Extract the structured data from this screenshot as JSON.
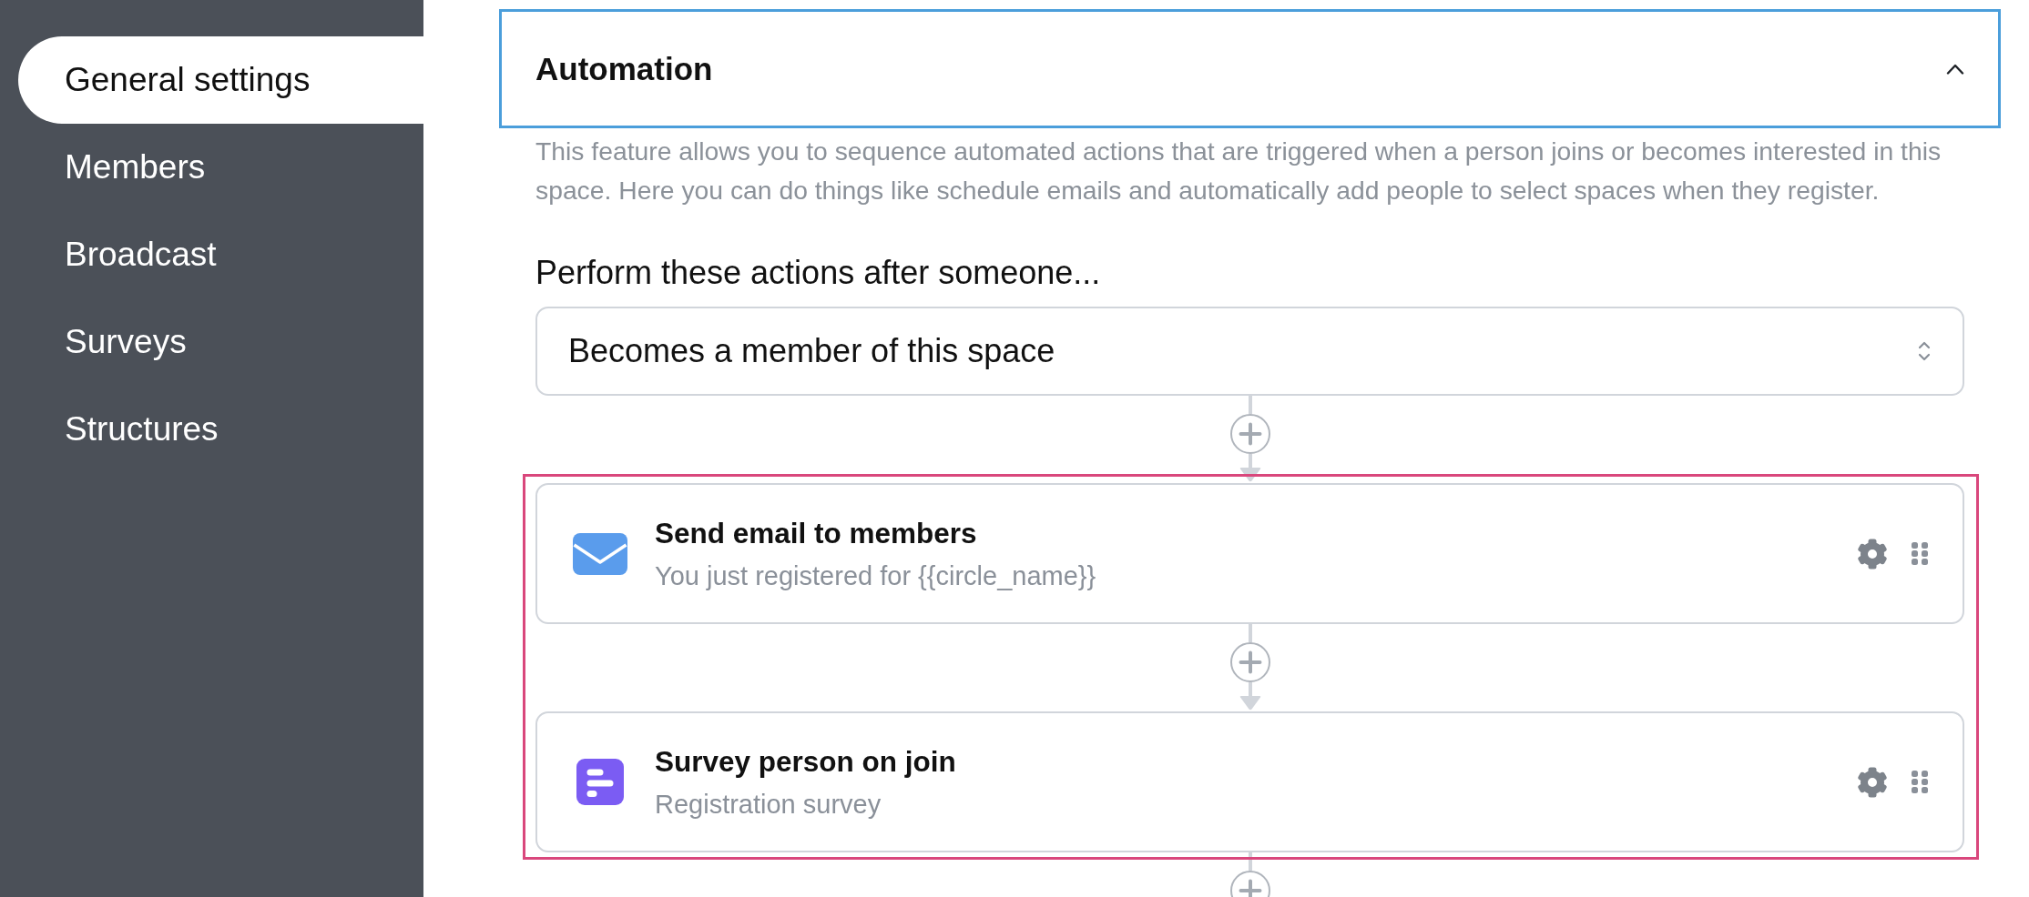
{
  "sidebar": {
    "items": [
      {
        "label": "General settings",
        "selected": true
      },
      {
        "label": "Members",
        "selected": false
      },
      {
        "label": "Broadcast",
        "selected": false
      },
      {
        "label": "Surveys",
        "selected": false
      },
      {
        "label": "Structures",
        "selected": false
      }
    ]
  },
  "section": {
    "title": "Automation",
    "expanded": true,
    "focused": true,
    "description": "This feature allows you to sequence automated actions that are triggered when a person joins or becomes interested in this space. Here you can do things like schedule emails and automatically add people to select spaces when they register."
  },
  "trigger": {
    "label": "Perform these actions after someone...",
    "value": "Becomes a member of this space"
  },
  "steps": {
    "highlighted": true,
    "items": [
      {
        "kind": "email",
        "title": "Send email to members",
        "subtitle": "You just registered for {{circle_name}}"
      },
      {
        "kind": "survey",
        "title": "Survey person on join",
        "subtitle": "Registration survey"
      }
    ]
  }
}
